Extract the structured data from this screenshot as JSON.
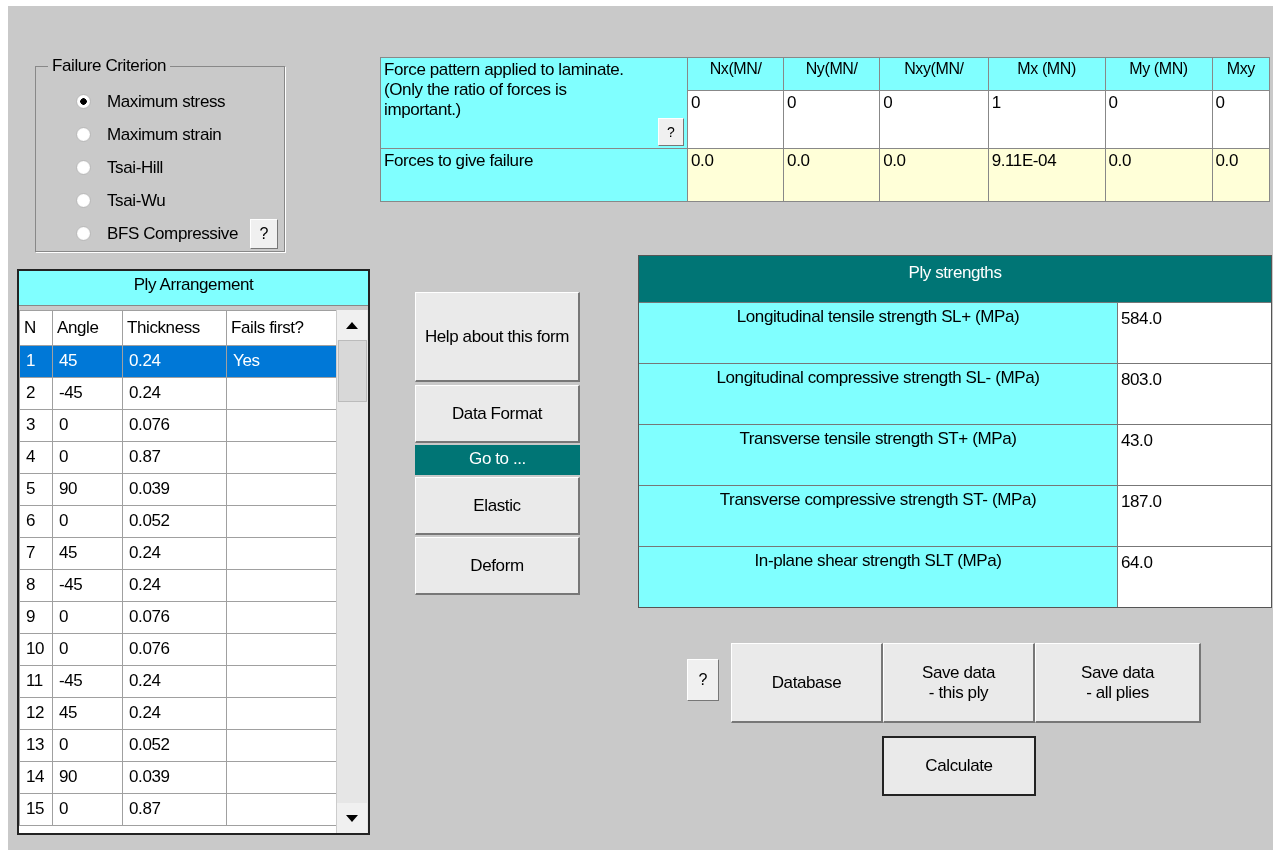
{
  "failure_criterion": {
    "title": "Failure Criterion",
    "options": [
      {
        "label": "Maximum stress",
        "selected": true
      },
      {
        "label": "Maximum strain",
        "selected": false
      },
      {
        "label": "Tsai-Hill",
        "selected": false
      },
      {
        "label": "Tsai-Wu",
        "selected": false
      },
      {
        "label": "BFS Compressive",
        "selected": false
      }
    ],
    "help": "?"
  },
  "ply_arrangement": {
    "title": "Ply Arrangement",
    "columns": [
      "N",
      "Angle",
      "Thickness",
      "Fails first?"
    ],
    "rows": [
      {
        "cells": [
          "1",
          "45",
          "0.24",
          "Yes"
        ],
        "selected": true
      },
      {
        "cells": [
          "2",
          "-45",
          "0.24",
          ""
        ],
        "selected": false
      },
      {
        "cells": [
          "3",
          "0",
          "0.076",
          ""
        ],
        "selected": false
      },
      {
        "cells": [
          "4",
          "0",
          "0.87",
          ""
        ],
        "selected": false
      },
      {
        "cells": [
          "5",
          "90",
          "0.039",
          ""
        ],
        "selected": false
      },
      {
        "cells": [
          "6",
          "0",
          "0.052",
          ""
        ],
        "selected": false
      },
      {
        "cells": [
          "7",
          "45",
          "0.24",
          ""
        ],
        "selected": false
      },
      {
        "cells": [
          "8",
          "-45",
          "0.24",
          ""
        ],
        "selected": false
      },
      {
        "cells": [
          "9",
          "0",
          "0.076",
          ""
        ],
        "selected": false
      },
      {
        "cells": [
          "10",
          "0",
          "0.076",
          ""
        ],
        "selected": false
      },
      {
        "cells": [
          "11",
          "-45",
          "0.24",
          ""
        ],
        "selected": false
      },
      {
        "cells": [
          "12",
          "45",
          "0.24",
          ""
        ],
        "selected": false
      },
      {
        "cells": [
          "13",
          "0",
          "0.052",
          ""
        ],
        "selected": false
      },
      {
        "cells": [
          "14",
          "90",
          "0.039",
          ""
        ],
        "selected": false
      },
      {
        "cells": [
          "15",
          "0",
          "0.87",
          ""
        ],
        "selected": false
      }
    ]
  },
  "side_buttons": [
    {
      "kind": "button",
      "label": "Help about this form"
    },
    {
      "kind": "button",
      "label": "Data Format"
    },
    {
      "kind": "heading",
      "label": "Go to ..."
    },
    {
      "kind": "button",
      "label": "Elastic"
    },
    {
      "kind": "button",
      "label": "Deform"
    }
  ],
  "forces": {
    "description": "Force pattern applied to laminate. (Only the ratio of forces is important.)",
    "help": "?",
    "columns": [
      "Nx(MN/",
      "Ny(MN/",
      "Nxy(MN/",
      "Mx (MN)",
      "My (MN)",
      "Mxy"
    ],
    "pattern": [
      "0",
      "0",
      "0",
      "1",
      "0",
      "0"
    ],
    "failure_label": "Forces to give failure",
    "failure": [
      "0.0",
      "0.0",
      "0.0",
      "9.11E-04",
      "0.0",
      "0.0"
    ]
  },
  "ply_strengths": {
    "title": "Ply strengths",
    "rows": [
      {
        "label": "Longitudinal tensile strength SL+ (MPa)",
        "value": "584.0"
      },
      {
        "label": "Longitudinal compressive strength SL- (MPa)",
        "value": "803.0"
      },
      {
        "label": "Transverse tensile strength ST+ (MPa)",
        "value": "43.0"
      },
      {
        "label": "Transverse compressive strength ST- (MPa)",
        "value": "187.0"
      },
      {
        "label": "In-plane shear strength SLT (MPa)",
        "value": "64.0"
      }
    ]
  },
  "actions": {
    "help": "?",
    "buttons": [
      "Database",
      "Save data\n- this ply",
      "Save data\n- all plies"
    ],
    "calculate": "Calculate"
  }
}
